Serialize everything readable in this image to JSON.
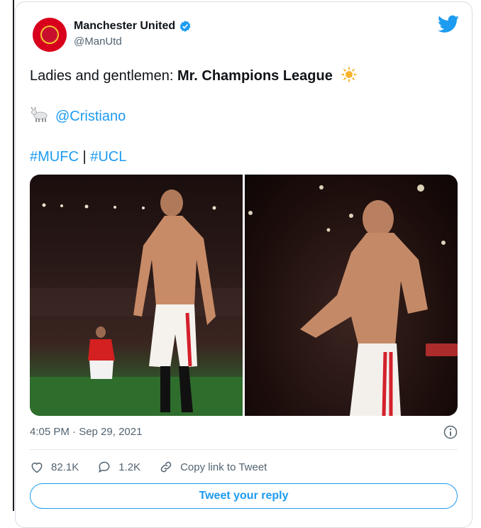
{
  "account": {
    "name": "Manchester United",
    "handle": "@ManUtd"
  },
  "tweet": {
    "line1_prefix": "Ladies and gentlemen: ",
    "line1_bold": "Mr. Champions League",
    "mention": "@Cristiano",
    "hashtag1": "#MUFC",
    "separator": "|",
    "hashtag2": "#UCL"
  },
  "meta": {
    "timestamp": "4:05 PM · Sep 29, 2021"
  },
  "actions": {
    "likes": "82.1K",
    "replies": "1.2K",
    "copy_link": "Copy link to Tweet"
  },
  "reply_button": "Tweet your reply",
  "colors": {
    "accent": "#1d9bf0",
    "text": "#0f1419",
    "muted": "#536471"
  },
  "icons": [
    "twitter-bird-icon",
    "verified-badge-icon",
    "sun-emoji-icon",
    "goat-emoji-icon",
    "info-icon",
    "heart-icon",
    "comment-icon",
    "link-icon"
  ]
}
